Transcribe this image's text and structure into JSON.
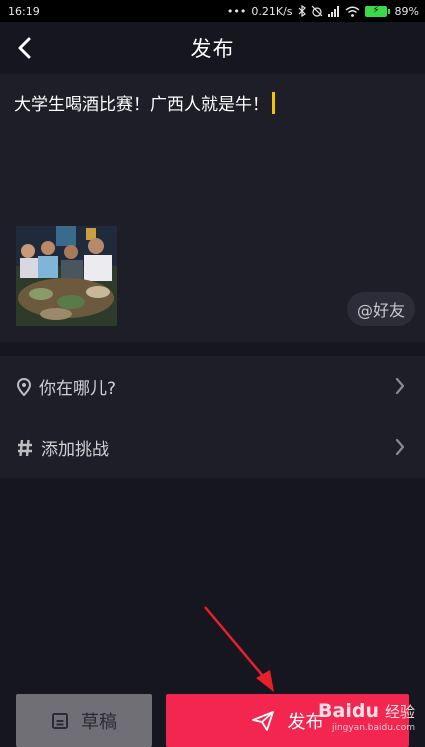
{
  "status_bar": {
    "time": "16:19",
    "network_speed": "0.21K/s",
    "battery_percent": "89%"
  },
  "header": {
    "title": "发布",
    "back_icon": "chevron-left-icon"
  },
  "compose": {
    "caption": "大学生喝酒比赛！广西人就是牛！",
    "mention_label": "@好友",
    "caret_color": "#f5c400"
  },
  "options": [
    {
      "icon": "location-pin-icon",
      "label": "你在哪儿?"
    },
    {
      "icon": "hashtag-icon",
      "label": "添加挑战"
    }
  ],
  "actions": {
    "draft_label": "草稿",
    "publish_label": "发布",
    "publish_color": "#f2264f"
  },
  "watermark": {
    "logo": "Baidu",
    "suffix": "经验",
    "url": "jingyan.baidu.com"
  }
}
